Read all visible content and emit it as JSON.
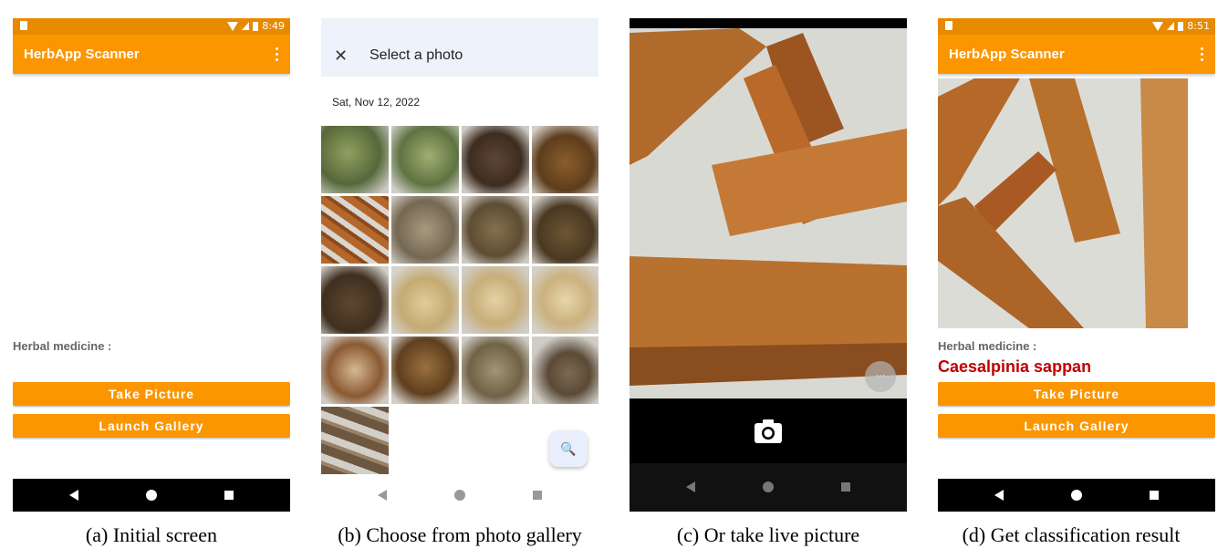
{
  "screens": {
    "initial": {
      "status_time": "8:49",
      "app_title": "HerbApp Scanner",
      "label": "Herbal medicine :",
      "take_picture": "Take Picture",
      "launch_gallery": "Launch Gallery"
    },
    "gallery": {
      "header_title": "Select a photo",
      "date_header": "Sat, Nov 12, 2022",
      "photos": [
        "leaves-1",
        "leaves-2",
        "twigs",
        "slices",
        "sticks",
        "shreds",
        "chunks-1",
        "chunks-2",
        "pellets",
        "wood-chips",
        "wood-chips-2",
        "wood-chips-3",
        "root-slice",
        "wood-block",
        "fibers",
        "flake",
        "roots"
      ]
    },
    "camera": {
      "icons": [
        "more-icon",
        "shutter-icon"
      ]
    },
    "result": {
      "status_time": "8:51",
      "app_title": "HerbApp Scanner",
      "label": "Herbal medicine :",
      "result": "Caesalpinia sappan",
      "take_picture": "Take Picture",
      "launch_gallery": "Launch Gallery"
    }
  },
  "captions": {
    "a": "(a) Initial screen",
    "b": "(b) Choose from photo gallery",
    "c": "(c) Or take live picture",
    "d": "(d) Get classification result"
  },
  "colors": {
    "primary": "#fb9600",
    "status_bar": "#e88a00",
    "result_text": "#c00000"
  }
}
